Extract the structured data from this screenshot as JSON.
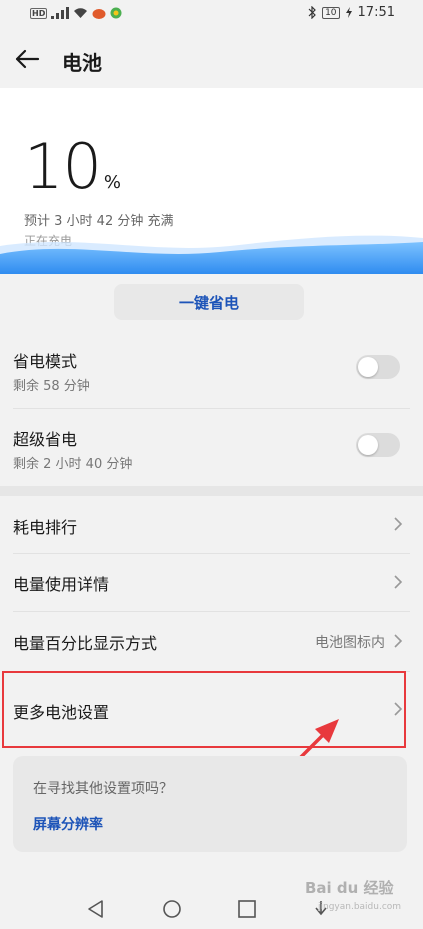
{
  "status_bar": {
    "network": "HD",
    "battery_level": "10",
    "time": "17:51"
  },
  "header": {
    "title": "电池"
  },
  "battery": {
    "percent": "10",
    "percent_sign": "%",
    "eta": "预计 3 小时 42 分钟 充满",
    "state": "正在充电"
  },
  "one_key_save": {
    "label": "一键省电"
  },
  "modes": [
    {
      "title": "省电模式",
      "subtitle": "剩余 58 分钟",
      "enabled": false
    },
    {
      "title": "超级省电",
      "subtitle": "剩余 2 小时 40 分钟",
      "enabled": false
    }
  ],
  "settings": [
    {
      "title": "耗电排行"
    },
    {
      "title": "电量使用详情"
    },
    {
      "title": "电量百分比显示方式",
      "value": "电池图标内"
    },
    {
      "title": "更多电池设置"
    }
  ],
  "suggestion": {
    "question": "在寻找其他设置项吗？",
    "link": "屏幕分辨率"
  },
  "watermark": {
    "brand": "Bai du 经验",
    "site": "jingyan.baidu.com"
  },
  "colors": {
    "accent": "#1d54b8",
    "highlight": "#e8393d",
    "wave": "#2f8cf0"
  }
}
